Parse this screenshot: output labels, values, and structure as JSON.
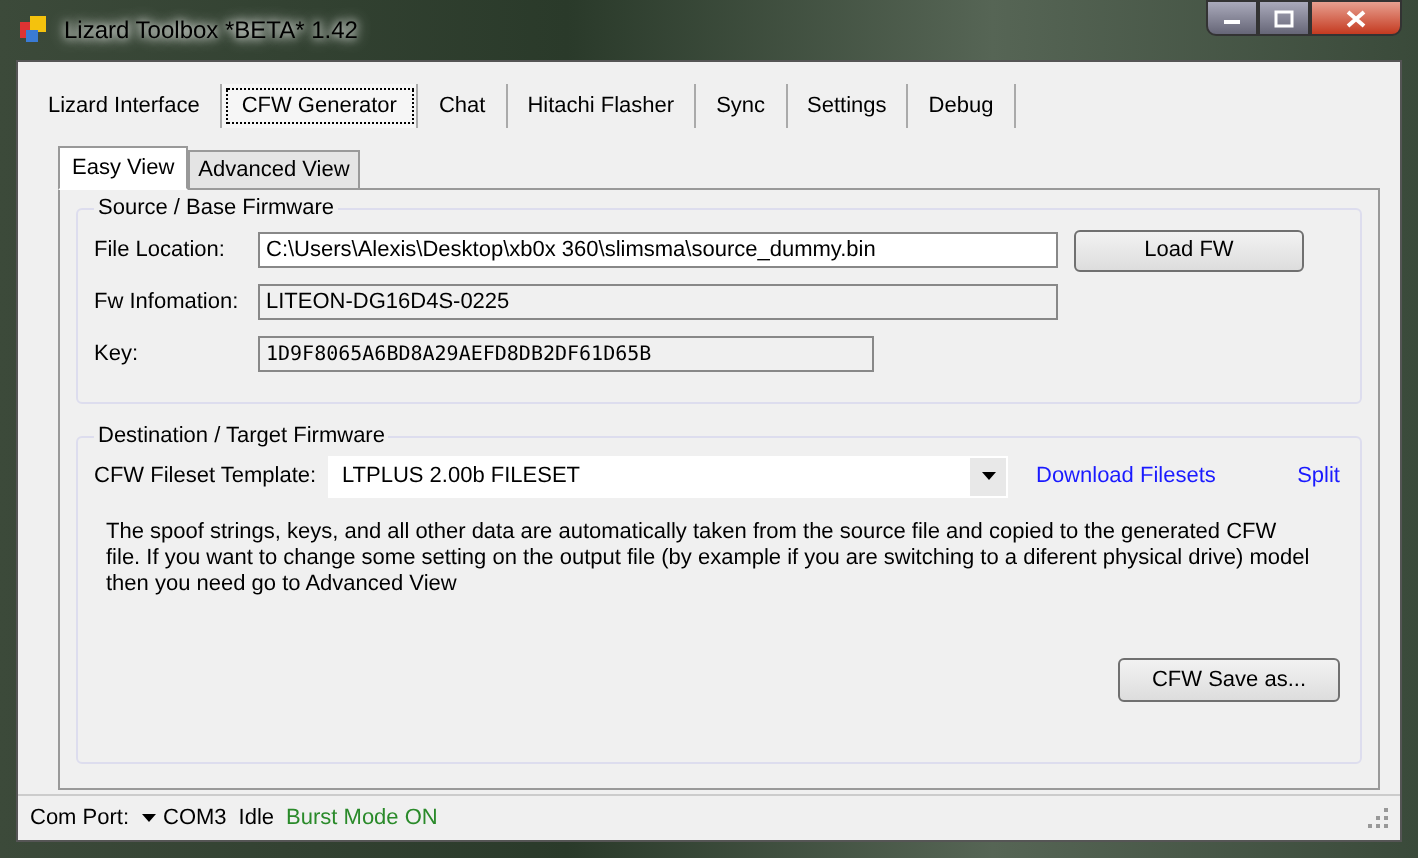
{
  "window": {
    "title": "Lizard Toolbox *BETA* 1.42"
  },
  "tabs": [
    {
      "label": "Lizard Interface",
      "selected": false
    },
    {
      "label": "CFW Generator",
      "selected": true
    },
    {
      "label": "Chat",
      "selected": false
    },
    {
      "label": "Hitachi Flasher",
      "selected": false
    },
    {
      "label": "Sync",
      "selected": false
    },
    {
      "label": "Settings",
      "selected": false
    },
    {
      "label": "Debug",
      "selected": false
    }
  ],
  "subtabs": [
    {
      "label": "Easy View",
      "selected": true
    },
    {
      "label": "Advanced View",
      "selected": false
    }
  ],
  "source": {
    "title": "Source / Base Firmware",
    "file_location_label": "File Location:",
    "file_location": "C:\\Users\\Alexis\\Desktop\\xb0x 360\\slimsma\\source_dummy.bin",
    "load_button": "Load FW",
    "fw_info_label": "Fw Infomation:",
    "fw_info": "LITEON-DG16D4S-0225",
    "key_label": "Key:",
    "key": "1D9F8065A6BD8A29AEFD8DB2DF61D65B"
  },
  "destination": {
    "title": "Destination / Target Firmware",
    "template_label": "CFW Fileset Template:",
    "template": "LTPLUS 2.00b FILESET",
    "download_link": "Download Filesets",
    "split_link": "Split",
    "description": "The spoof strings, keys, and all other data are automatically taken from the source file and copied to the generated CFW file.  If you want to change some setting on the output file (by example if you are switching to a diferent physical drive) model then you need go to Advanced View",
    "save_button": "CFW Save as..."
  },
  "status_bar": {
    "com_port_label": "Com Port:",
    "com_port": "COM3",
    "state": "Idle",
    "burst_mode": "Burst Mode ON"
  }
}
